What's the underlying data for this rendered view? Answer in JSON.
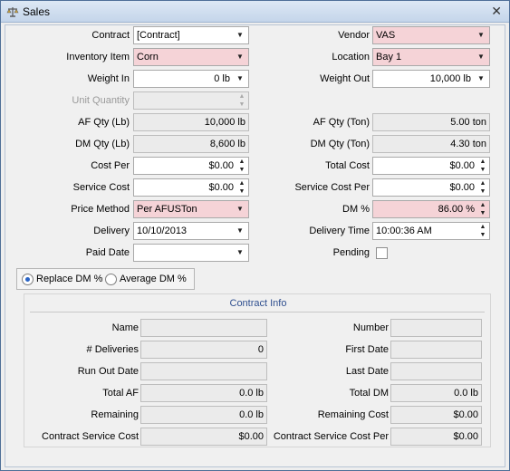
{
  "window": {
    "title": "Sales",
    "icon": "scale-icon",
    "close_icon": "close-icon"
  },
  "fields": {
    "contract": {
      "label": "Contract",
      "value": "[Contract]"
    },
    "vendor": {
      "label": "Vendor",
      "value": "VAS"
    },
    "inventory_item": {
      "label": "Inventory Item",
      "value": "Corn"
    },
    "location": {
      "label": "Location",
      "value": "Bay 1"
    },
    "weight_in": {
      "label": "Weight In",
      "value": "0 lb"
    },
    "weight_out": {
      "label": "Weight Out",
      "value": "10,000 lb"
    },
    "unit_quantity": {
      "label": "Unit Quantity",
      "value": ""
    },
    "af_qty_lb": {
      "label": "AF Qty (Lb)",
      "value": "10,000 lb"
    },
    "af_qty_ton": {
      "label": "AF Qty (Ton)",
      "value": "5.00 ton"
    },
    "dm_qty_lb": {
      "label": "DM Qty (Lb)",
      "value": "8,600 lb"
    },
    "dm_qty_ton": {
      "label": "DM Qty (Ton)",
      "value": "4.30 ton"
    },
    "cost_per": {
      "label": "Cost Per",
      "value": "$0.00"
    },
    "total_cost": {
      "label": "Total Cost",
      "value": "$0.00"
    },
    "service_cost": {
      "label": "Service Cost",
      "value": "$0.00"
    },
    "service_cost_per": {
      "label": "Service Cost Per",
      "value": "$0.00"
    },
    "price_method": {
      "label": "Price Method",
      "value": "Per AFUSTon"
    },
    "dm_percent": {
      "label": "DM %",
      "value": "86.00 %"
    },
    "delivery": {
      "label": "Delivery",
      "value": "10/10/2013"
    },
    "delivery_time": {
      "label": "Delivery Time",
      "value": "10:00:36 AM"
    },
    "paid_date": {
      "label": "Paid Date",
      "value": ""
    },
    "pending": {
      "label": "Pending",
      "checked": false
    }
  },
  "dm_mode": {
    "replace_label": "Replace DM %",
    "average_label": "Average DM %",
    "selected": "replace"
  },
  "contract_info": {
    "title": "Contract Info",
    "name": {
      "label": "Name",
      "value": ""
    },
    "number": {
      "label": "Number",
      "value": ""
    },
    "deliveries": {
      "label": "# Deliveries",
      "value": "0"
    },
    "first_date": {
      "label": "First Date",
      "value": ""
    },
    "run_out_date": {
      "label": "Run Out Date",
      "value": ""
    },
    "last_date": {
      "label": "Last Date",
      "value": ""
    },
    "total_af": {
      "label": "Total AF",
      "value": "0.0 lb"
    },
    "total_dm": {
      "label": "Total DM",
      "value": "0.0 lb"
    },
    "remaining": {
      "label": "Remaining",
      "value": "0.0 lb"
    },
    "remaining_cost": {
      "label": "Remaining Cost",
      "value": "$0.00"
    },
    "contract_service_cost": {
      "label": "Contract Service Cost",
      "value": "$0.00"
    },
    "contract_service_cost_per": {
      "label": "Contract Service Cost Per",
      "value": "$0.00"
    }
  },
  "colors": {
    "required_field": "#f5d3d7",
    "readonly_field": "#ebebeb",
    "group_title": "#2f4f8f"
  }
}
